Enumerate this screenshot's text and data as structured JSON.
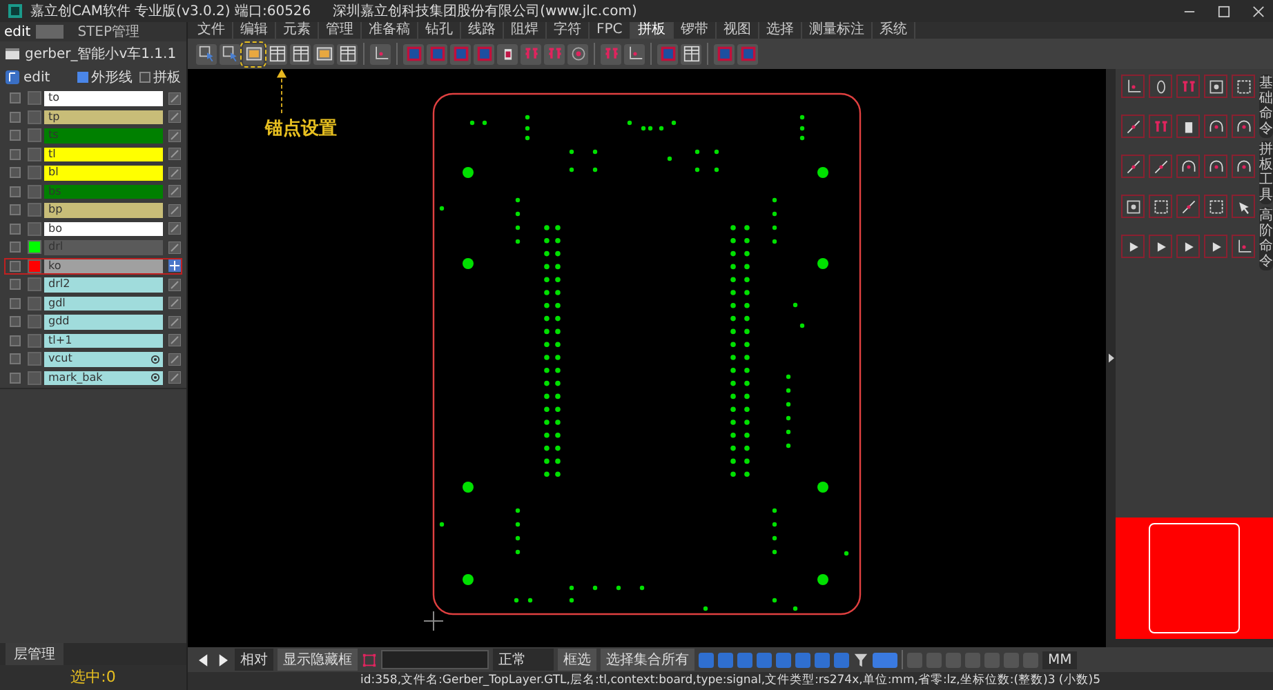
{
  "window": {
    "title": "嘉立创CAM软件 专业版(v3.0.2) 端口:60526",
    "company": "深圳嘉立创科技集团股份有限公司(www.jlc.com)"
  },
  "left_panel": {
    "tabs": [
      {
        "label": "edit",
        "selected": true
      },
      {
        "label": "STEP管理",
        "selected": false
      }
    ],
    "job": "gerber_智能小v车1.1.1",
    "step": "edit",
    "options": [
      {
        "label": "外形线",
        "checked": true
      },
      {
        "label": "拼板",
        "checked": false
      }
    ],
    "layers": [
      {
        "name": "to",
        "color": "#ffffff",
        "swatch": {
          "color": "#555555"
        },
        "selected": false,
        "marked": false
      },
      {
        "name": "tp",
        "color": "#c8bd78",
        "swatch": {
          "color": "#555555"
        },
        "selected": false,
        "marked": false
      },
      {
        "name": "ts",
        "color": "#008000",
        "swatch": {
          "color": "#555555"
        },
        "selected": false,
        "marked": false
      },
      {
        "name": "tl",
        "color": "#ffff00",
        "swatch": {
          "color": "#555555"
        },
        "selected": false,
        "marked": false
      },
      {
        "name": "bl",
        "color": "#ffff00",
        "swatch": {
          "color": "#555555"
        },
        "selected": false,
        "marked": false
      },
      {
        "name": "bs",
        "color": "#008000",
        "swatch": {
          "color": "#555555"
        },
        "selected": false,
        "marked": false
      },
      {
        "name": "bp",
        "color": "#c8bd78",
        "swatch": {
          "color": "#555555"
        },
        "selected": false,
        "marked": false
      },
      {
        "name": "bo",
        "color": "#ffffff",
        "swatch": {
          "color": "#555555"
        },
        "selected": false,
        "marked": false
      },
      {
        "name": "drl",
        "color": "#5a5a5a",
        "swatch": {
          "color": "#00ff00"
        },
        "selected": false,
        "marked": false
      },
      {
        "name": "ko",
        "color": "#a0a0a0",
        "swatch": {
          "color": "#ff0000"
        },
        "selected": true,
        "marked": false
      },
      {
        "name": "drl2",
        "color": "#a0dcdc",
        "swatch": {
          "color": "#555555"
        },
        "selected": false,
        "marked": false
      },
      {
        "name": "gdl",
        "color": "#a0dcdc",
        "swatch": {
          "color": "#555555"
        },
        "selected": false,
        "marked": false
      },
      {
        "name": "gdd",
        "color": "#a0dcdc",
        "swatch": {
          "color": "#555555"
        },
        "selected": false,
        "marked": false
      },
      {
        "name": "tl+1",
        "color": "#a0dcdc",
        "swatch": {
          "color": "#555555"
        },
        "selected": false,
        "marked": false
      },
      {
        "name": "vcut",
        "color": "#a0dcdc",
        "swatch": {
          "color": "#555555"
        },
        "selected": false,
        "marked": true
      },
      {
        "name": "mark_bak",
        "color": "#a0dcdc",
        "swatch": {
          "color": "#555555"
        },
        "selected": false,
        "marked": true
      }
    ],
    "bottom_tab": "层管理",
    "selection_count": "选中:0"
  },
  "menu": [
    {
      "label": "文件",
      "selected": false
    },
    {
      "label": "编辑",
      "selected": false
    },
    {
      "label": "元素",
      "selected": false
    },
    {
      "label": "管理",
      "selected": false
    },
    {
      "label": "准备稿",
      "selected": false
    },
    {
      "label": "钻孔",
      "selected": false
    },
    {
      "label": "线路",
      "selected": false
    },
    {
      "label": "阻焊",
      "selected": false
    },
    {
      "label": "字符",
      "selected": false
    },
    {
      "label": "FPC",
      "selected": false
    },
    {
      "label": "拼板",
      "selected": true
    },
    {
      "label": "锣带",
      "selected": false
    },
    {
      "label": "视图",
      "selected": false
    },
    {
      "label": "选择",
      "selected": false
    },
    {
      "label": "测量标注",
      "selected": false
    },
    {
      "label": "系统",
      "selected": false
    }
  ],
  "annotation": {
    "label": "锚点设置"
  },
  "right_panel": {
    "vertical_tabs": [
      "基础命令",
      "拼板工具",
      "高阶命令"
    ]
  },
  "bottom_toolbar": {
    "mode": "相对",
    "toggle": "显示隐藏框",
    "state": "正常",
    "select_button": "框选",
    "select_all": "选择集合所有",
    "unit": "MM"
  },
  "status_bar": "id:358,文件名:Gerber_TopLayer.GTL,层名:tl,context:board,type:signal,文件类型:rs274x,单位:mm,省零:lz,坐标位数:(整数)3 (小数)5"
}
